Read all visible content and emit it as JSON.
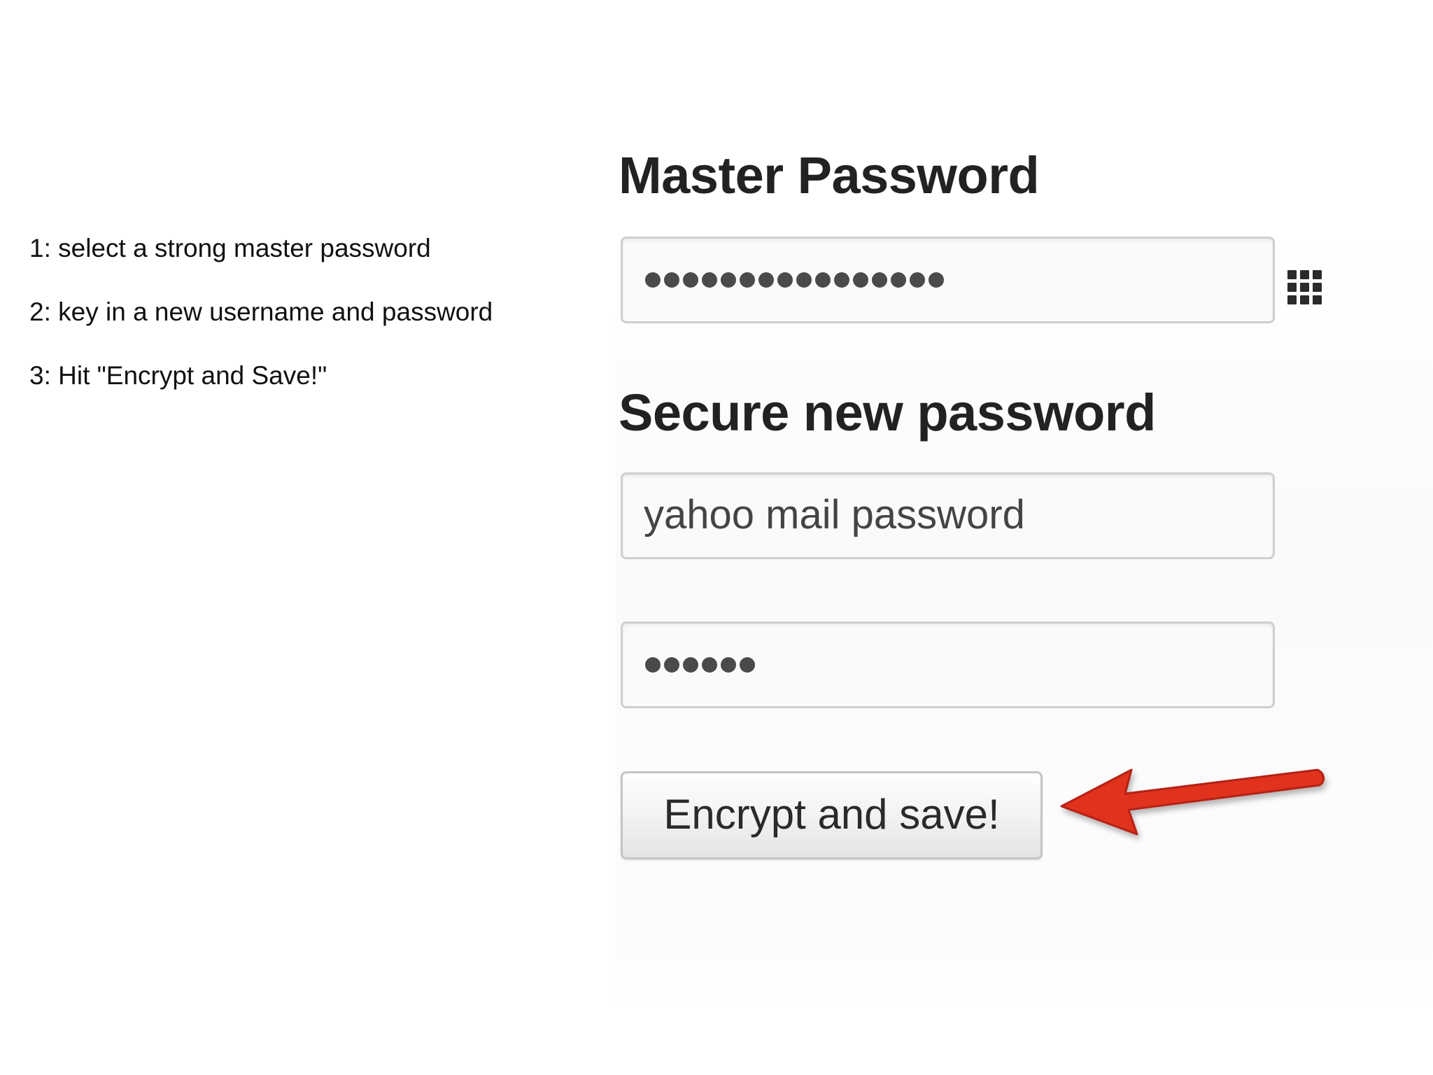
{
  "instructions": {
    "steps": [
      "1: select a strong master password",
      "2: key in a new username and password",
      "3: Hit \"Encrypt and Save!\""
    ]
  },
  "master": {
    "heading": "Master Password",
    "masked_length": 16,
    "keypad_icon": "keypad-grid-icon"
  },
  "secure": {
    "heading": "Secure new password",
    "name_value": "yahoo mail password",
    "password_masked_length": 6
  },
  "button": {
    "label": "Encrypt and save!"
  },
  "colors": {
    "arrow": "#e0321f",
    "heading": "#222222"
  }
}
